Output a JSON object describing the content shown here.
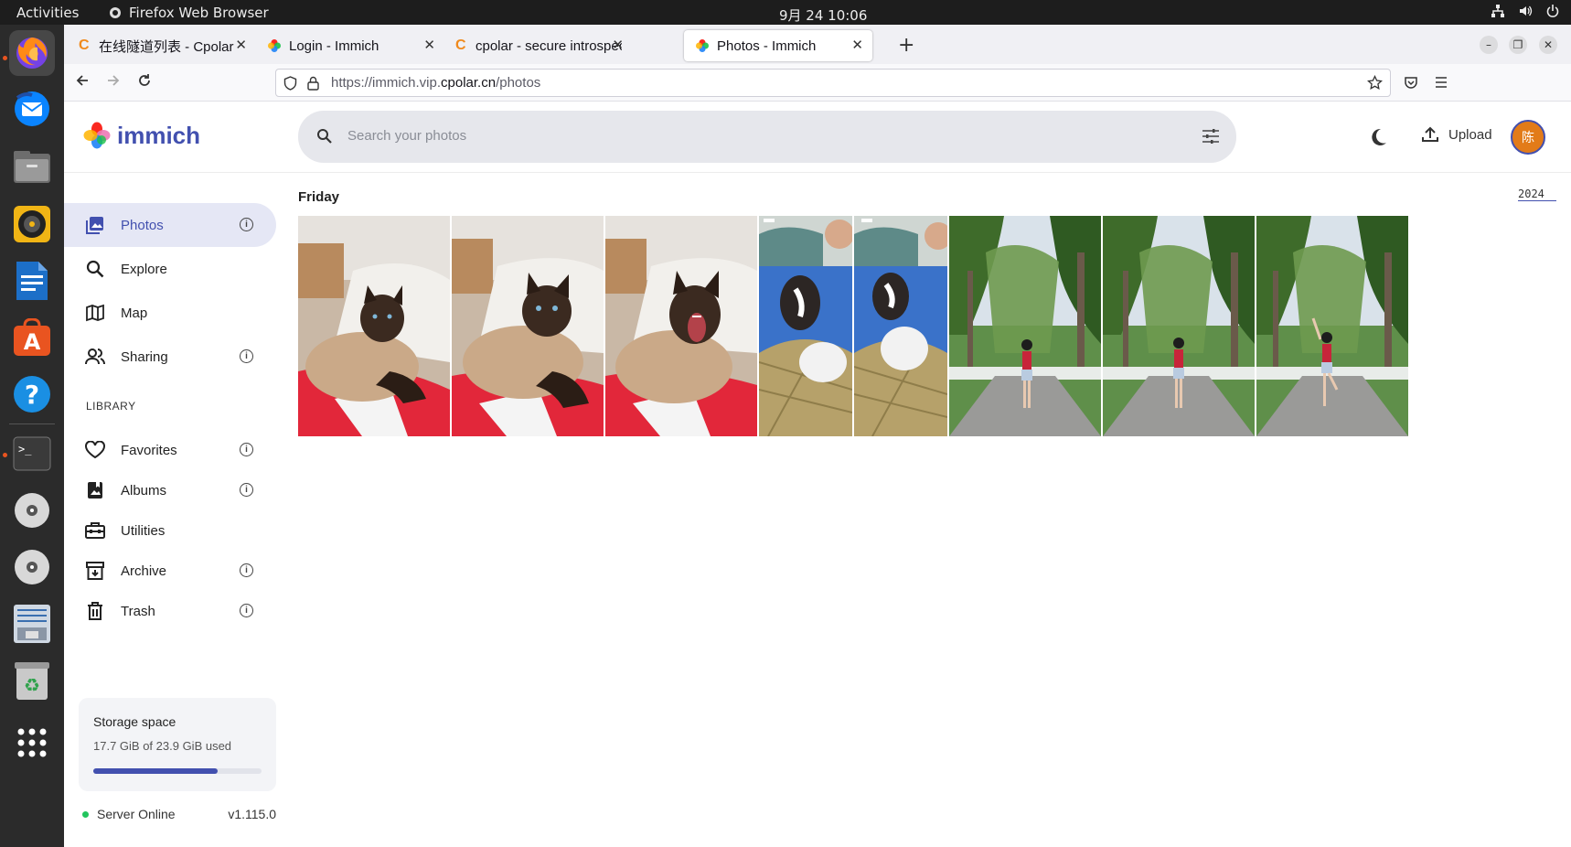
{
  "os": {
    "activities": "Activities",
    "app_name": "Firefox Web Browser",
    "clock": "9月 24  10:06"
  },
  "dock": {
    "items": [
      "firefox-icon",
      "thunderbird-icon",
      "files-icon",
      "rhythmbox-icon",
      "writer-icon",
      "software-icon",
      "help-icon",
      "terminal-icon",
      "disc-icon",
      "disc-icon",
      "text-editor-icon",
      "trash-icon",
      "app-grid-icon"
    ]
  },
  "browser": {
    "tabs": [
      {
        "title": "在线隧道列表 - Cpolar",
        "favicon": "cpolar-icon"
      },
      {
        "title": "Login - Immich",
        "favicon": "immich-icon"
      },
      {
        "title": "cpolar - secure introspect",
        "favicon": "cpolar-icon"
      },
      {
        "title": "Photos - Immich",
        "favicon": "immich-icon",
        "active": true
      }
    ],
    "url_prefix": "https://immich.vip.",
    "url_domain": "cpolar.cn",
    "url_path": "/photos"
  },
  "app": {
    "logo_text": "immich",
    "search_placeholder": "Search your photos",
    "upload_label": "Upload",
    "avatar_initial": "陈",
    "nav": [
      {
        "label": "Photos",
        "icon": "photos-icon",
        "info": true,
        "active": true
      },
      {
        "label": "Explore",
        "icon": "explore-icon",
        "info": false
      },
      {
        "label": "Map",
        "icon": "map-icon",
        "info": false
      },
      {
        "label": "Sharing",
        "icon": "sharing-icon",
        "info": true
      }
    ],
    "library_heading": "LIBRARY",
    "library": [
      {
        "label": "Favorites",
        "icon": "heart-icon",
        "info": true
      },
      {
        "label": "Albums",
        "icon": "albums-icon",
        "info": true
      },
      {
        "label": "Utilities",
        "icon": "utilities-icon",
        "info": false
      },
      {
        "label": "Archive",
        "icon": "archive-icon",
        "info": true
      },
      {
        "label": "Trash",
        "icon": "trash-icon",
        "info": true
      }
    ],
    "storage": {
      "title": "Storage space",
      "usage": "17.7 GiB of 23.9 GiB used",
      "fraction": 0.74
    },
    "server": {
      "status": "Server Online",
      "version": "v1.115.0"
    },
    "timeline": {
      "group_label": "Friday",
      "year": "2024",
      "photos": [
        {
          "subject": "cat-photo"
        },
        {
          "subject": "cat-photo"
        },
        {
          "subject": "cat-yawning-photo"
        },
        {
          "subject": "guinea-pigs-photo"
        },
        {
          "subject": "guinea-pigs-photo"
        },
        {
          "subject": "park-girl-photo"
        },
        {
          "subject": "park-girl-photo"
        },
        {
          "subject": "park-girl-pose-photo"
        }
      ]
    },
    "colors": {
      "accent": "#4250af",
      "online": "#22c55e",
      "avatar": "#e27b19"
    }
  }
}
